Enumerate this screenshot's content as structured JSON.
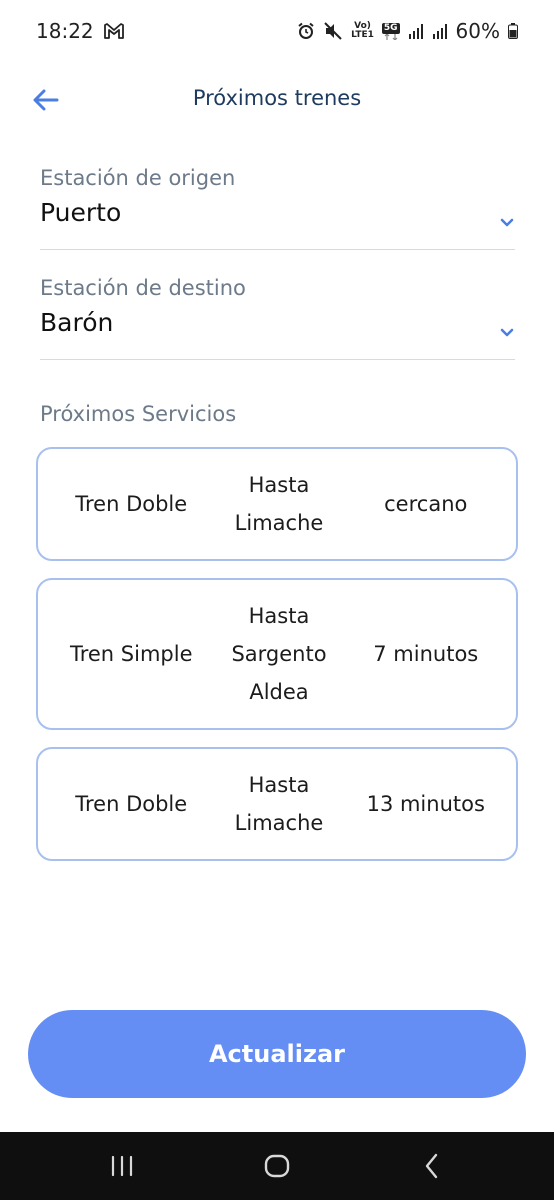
{
  "status_bar": {
    "time": "18:22",
    "volte_label": "Vo)",
    "lte_label": "LTE1",
    "fiveg_label": "5G",
    "battery": "60%"
  },
  "header": {
    "title": "Próximos trenes"
  },
  "origin": {
    "label": "Estación de origen",
    "value": "Puerto"
  },
  "destination": {
    "label": "Estación de destino",
    "value": "Barón"
  },
  "services": {
    "title": "Próximos Servicios",
    "items": [
      {
        "type": "Tren Doble",
        "destination": [
          "Hasta",
          "Limache"
        ],
        "eta": "cercano"
      },
      {
        "type": "Tren Simple",
        "destination": [
          "Hasta",
          "Sargento",
          "Aldea"
        ],
        "eta": "7 minutos"
      },
      {
        "type": "Tren Doble",
        "destination": [
          "Hasta",
          "Limache"
        ],
        "eta": "13 minutos"
      }
    ]
  },
  "actions": {
    "update_label": "Actualizar"
  },
  "colors": {
    "accent": "#658ef4",
    "card_border": "#a8c0ef",
    "title": "#1e3a5f",
    "label": "#6c7a89"
  },
  "icons": {
    "back": "arrow-left-icon",
    "chevron": "chevron-down-icon",
    "recents": "recents-icon",
    "home": "home-icon",
    "nav_back": "chevron-left-icon"
  }
}
